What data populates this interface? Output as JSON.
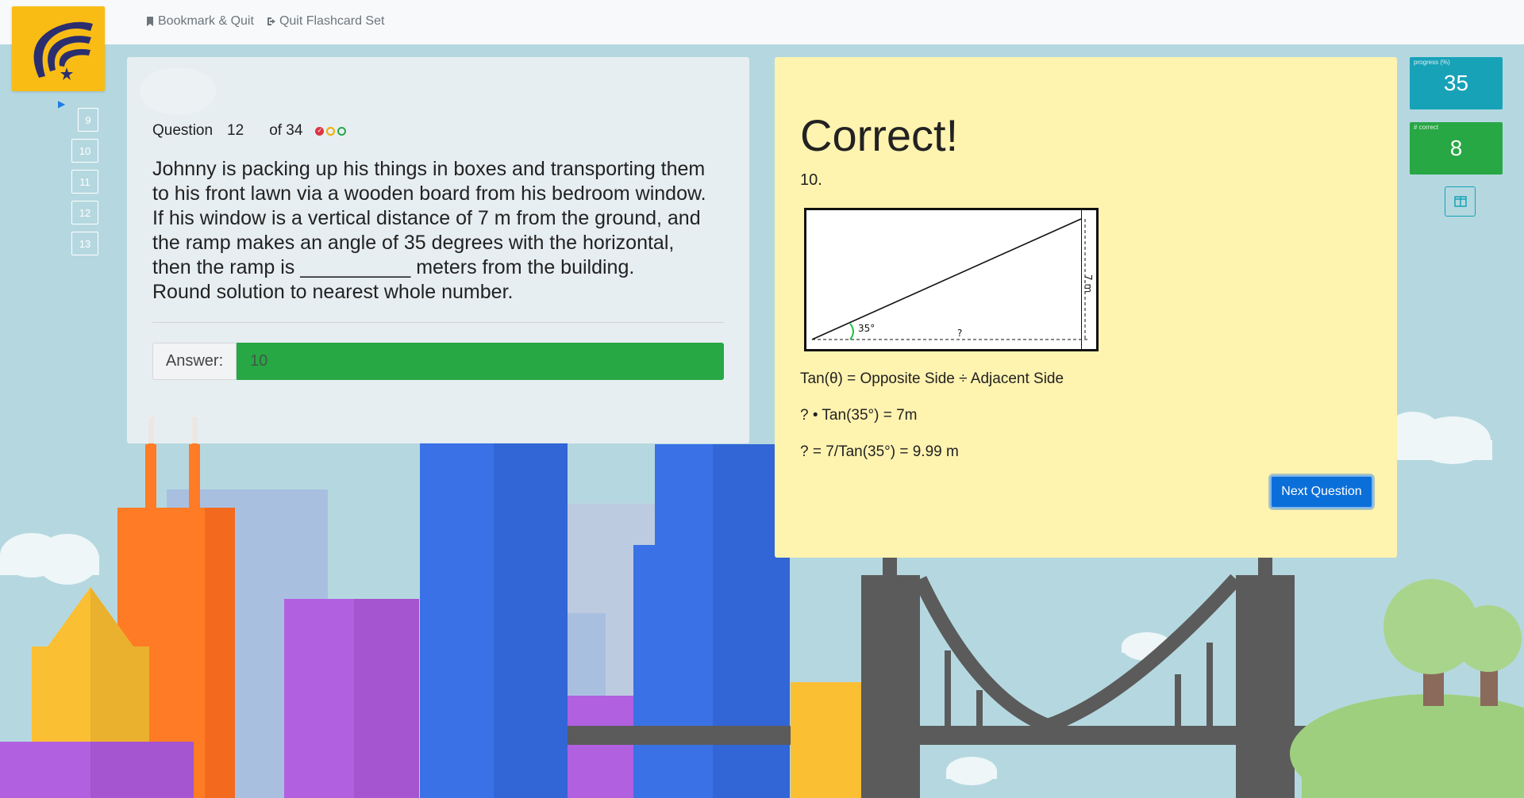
{
  "topbar": {
    "bookmark_label": "Bookmark & Quit",
    "quit_label": "Quit Flashcard Set"
  },
  "nav": {
    "questions": [
      "9",
      "10",
      "11",
      "12",
      "13"
    ],
    "current": "12"
  },
  "question": {
    "label": "Question",
    "number": "12",
    "total": "of 34",
    "text_lines": [
      "Johnny is packing up his things in boxes and transporting them",
      "to his front lawn via a wooden board from his bedroom window.",
      "If his window is a vertical distance of 7 m from the ground, and",
      "the ramp makes an angle of 35 degrees with the horizontal,",
      "then the ramp is __________ meters from the building.",
      "Round solution to nearest whole number."
    ],
    "answer_label": "Answer:",
    "answer_value": "10"
  },
  "result": {
    "title": "Correct!",
    "number": "10.",
    "diagram": {
      "angle_label": "35°",
      "base_label": "?",
      "height_label": "7 m"
    },
    "formula_lines": [
      "Tan(θ) = Opposite Side ÷ Adjacent Side",
      "? • Tan(35°) = 7m",
      "? = 7/Tan(35°) = 9.99 m"
    ],
    "next_label": "Next Question"
  },
  "stats": {
    "progress_label": "progress (%)",
    "progress_value": "35",
    "correct_label": "# correct",
    "correct_value": "8"
  },
  "colors": {
    "sky": "#b5d8e0",
    "accent": "#0b6fd9",
    "correct": "#28a745",
    "info": "#17a2b8",
    "result_bg": "#fff3b0",
    "logo_bg": "#f9bc15"
  }
}
